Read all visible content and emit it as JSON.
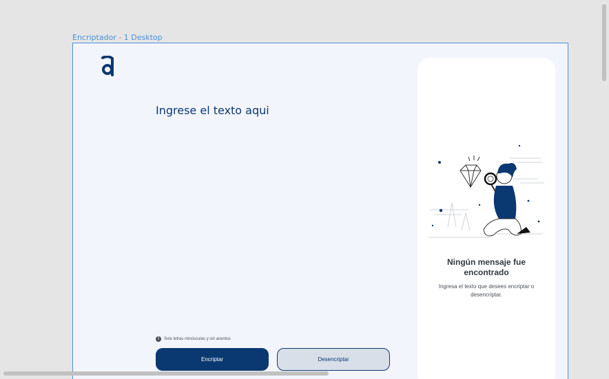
{
  "frame": {
    "label": "Encriptador - 1 Desktop"
  },
  "input": {
    "placeholder": "Ingrese el texto aqui"
  },
  "hint": {
    "icon": "info-icon",
    "text": "Solo letras minúsculas y sin acentos"
  },
  "buttons": {
    "encrypt": "Encriptar",
    "decrypt": "Desencriptar"
  },
  "output": {
    "illustration": "person-with-magnifying-glass-and-diamond",
    "title": "Ningún mensaje fue encontrado",
    "text": "Ingresa el texto que desees encriptar o desencriptar."
  },
  "colors": {
    "primary": "#0a3871",
    "background": "#f3f5fc",
    "canvas": "#e5e5e5",
    "frame_border": "#4a90d9"
  }
}
